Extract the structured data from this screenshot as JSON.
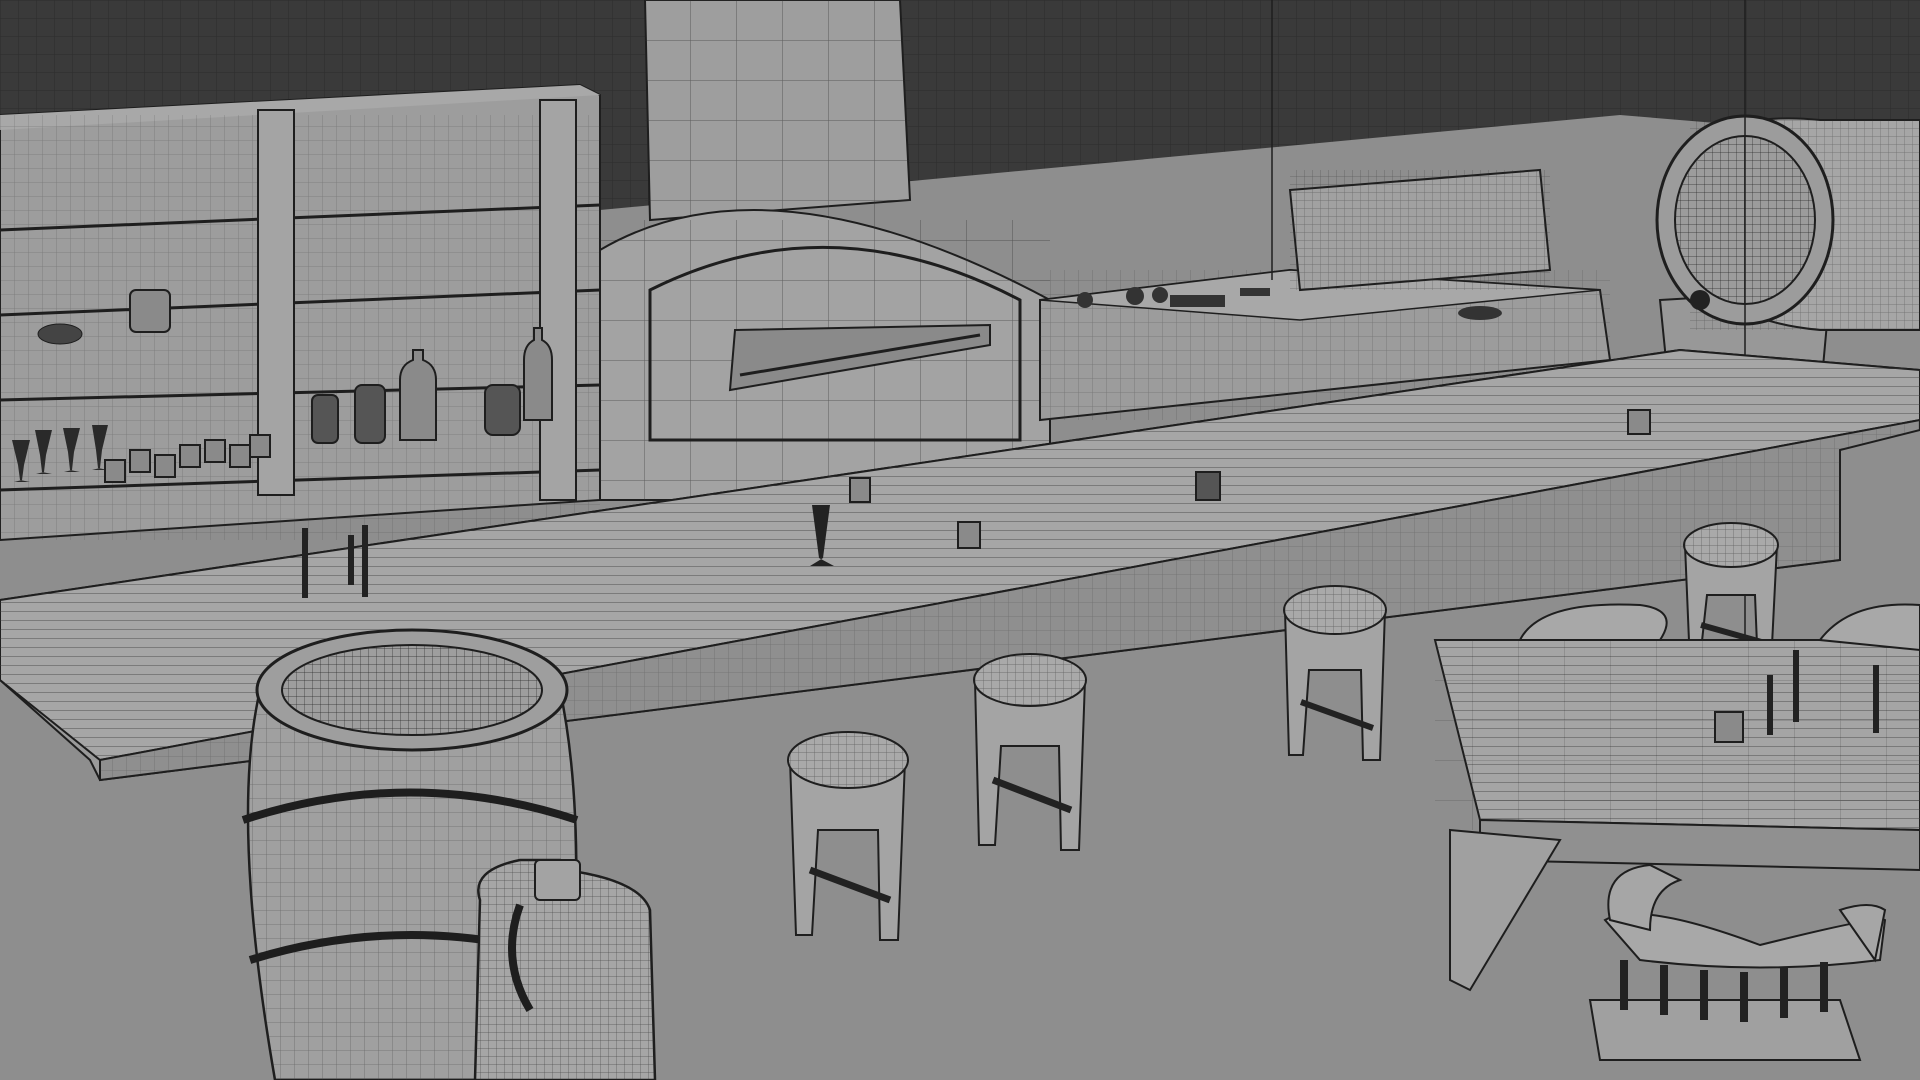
{
  "viewport": {
    "mode": "wireframe-overlay",
    "objects": [
      "shelving-unit",
      "stone-fireplace",
      "bar-counter",
      "back-counter",
      "wine-barrel-on-stand",
      "barrel-foreground",
      "jug",
      "bar-stools",
      "dining-table",
      "chairs",
      "candles",
      "wine-glasses",
      "mugs",
      "bottles"
    ],
    "stool_count": 4,
    "colors": {
      "background_grid": "#3a3a3a",
      "floor": "#8e8e8e",
      "surface": "#9b9b9b",
      "surface_light": "#a6a6a6",
      "surface_dark": "#7d7d7d",
      "wire": "#1e1e1e"
    }
  }
}
